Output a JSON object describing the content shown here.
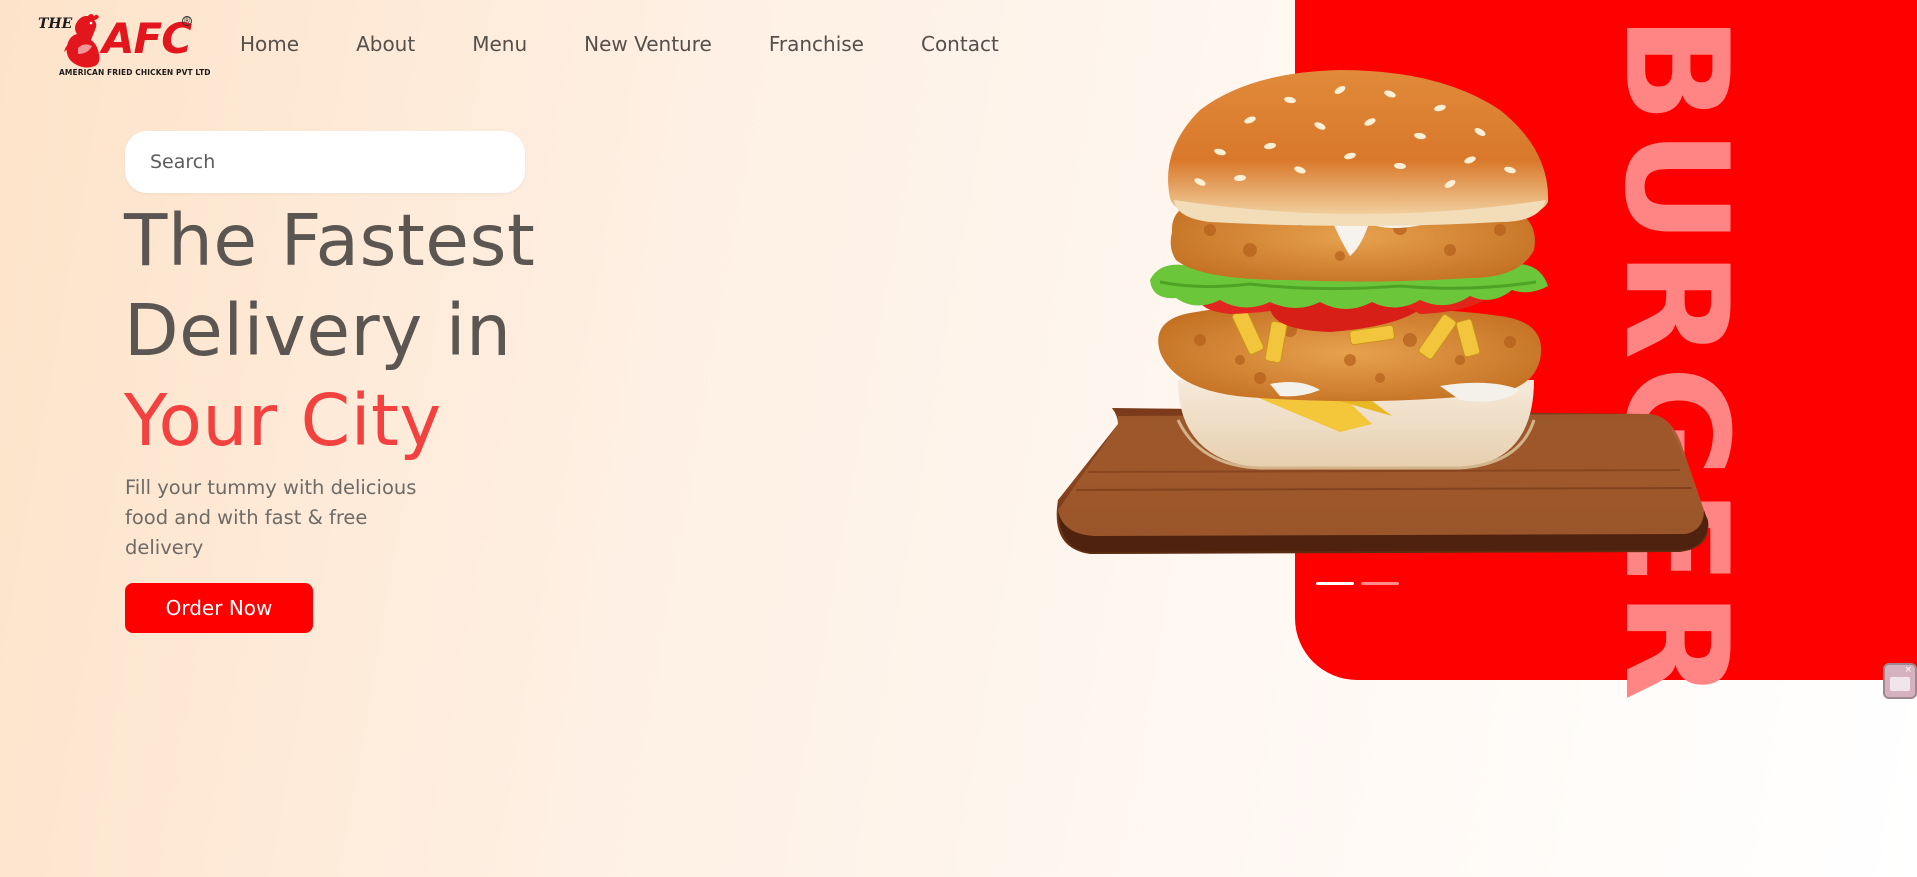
{
  "brand": {
    "prefix": "THE",
    "name": "AFC",
    "registered": "®",
    "tagline": "AMERICAN FRIED CHICKEN PVT LTD",
    "color": "#e3151d"
  },
  "nav": {
    "items": [
      {
        "label": "Home"
      },
      {
        "label": "About"
      },
      {
        "label": "Menu"
      },
      {
        "label": "New Venture"
      },
      {
        "label": "Franchise"
      },
      {
        "label": "Contact"
      }
    ]
  },
  "search": {
    "placeholder": "Search",
    "value": ""
  },
  "hero": {
    "line1": "The Fastest",
    "line2": "Delivery in",
    "line3": "Your City",
    "subtitle": "Fill your tummy with delicious food and with fast & free delivery",
    "cta_label": "Order Now"
  },
  "showcase": {
    "vertical_word": "BURGER",
    "panel_color": "#ff0000",
    "image_icon": "burger-image",
    "slides": {
      "total": 2,
      "active": 1
    }
  },
  "colors": {
    "accent": "#ff0000",
    "heading": "#5b5651",
    "highlight": "#f2413f"
  }
}
